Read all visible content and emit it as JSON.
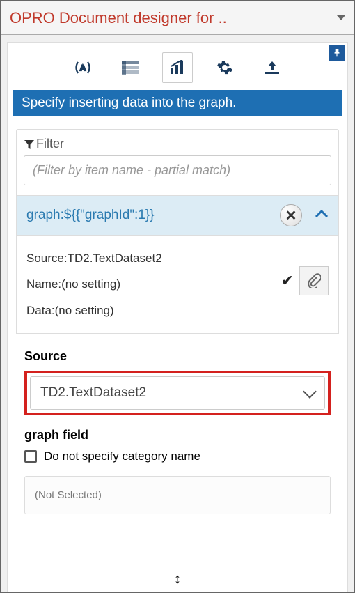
{
  "header": {
    "title": "OPRO Document designer for .."
  },
  "section_title": "Specify inserting data into the graph.",
  "filter": {
    "label": "Filter",
    "placeholder": "(Filter by item name - partial match)"
  },
  "graph": {
    "id_text": "graph:${{\"graphId\":1}}",
    "source_line": "Source:TD2.TextDataset2",
    "name_line": "Name:(no setting)",
    "data_line": "Data:(no setting)"
  },
  "source": {
    "label": "Source",
    "value": "TD2.TextDataset2"
  },
  "graph_field": {
    "label": "graph field",
    "checkbox_label": "Do not specify category name",
    "not_selected": "(Not Selected)"
  }
}
